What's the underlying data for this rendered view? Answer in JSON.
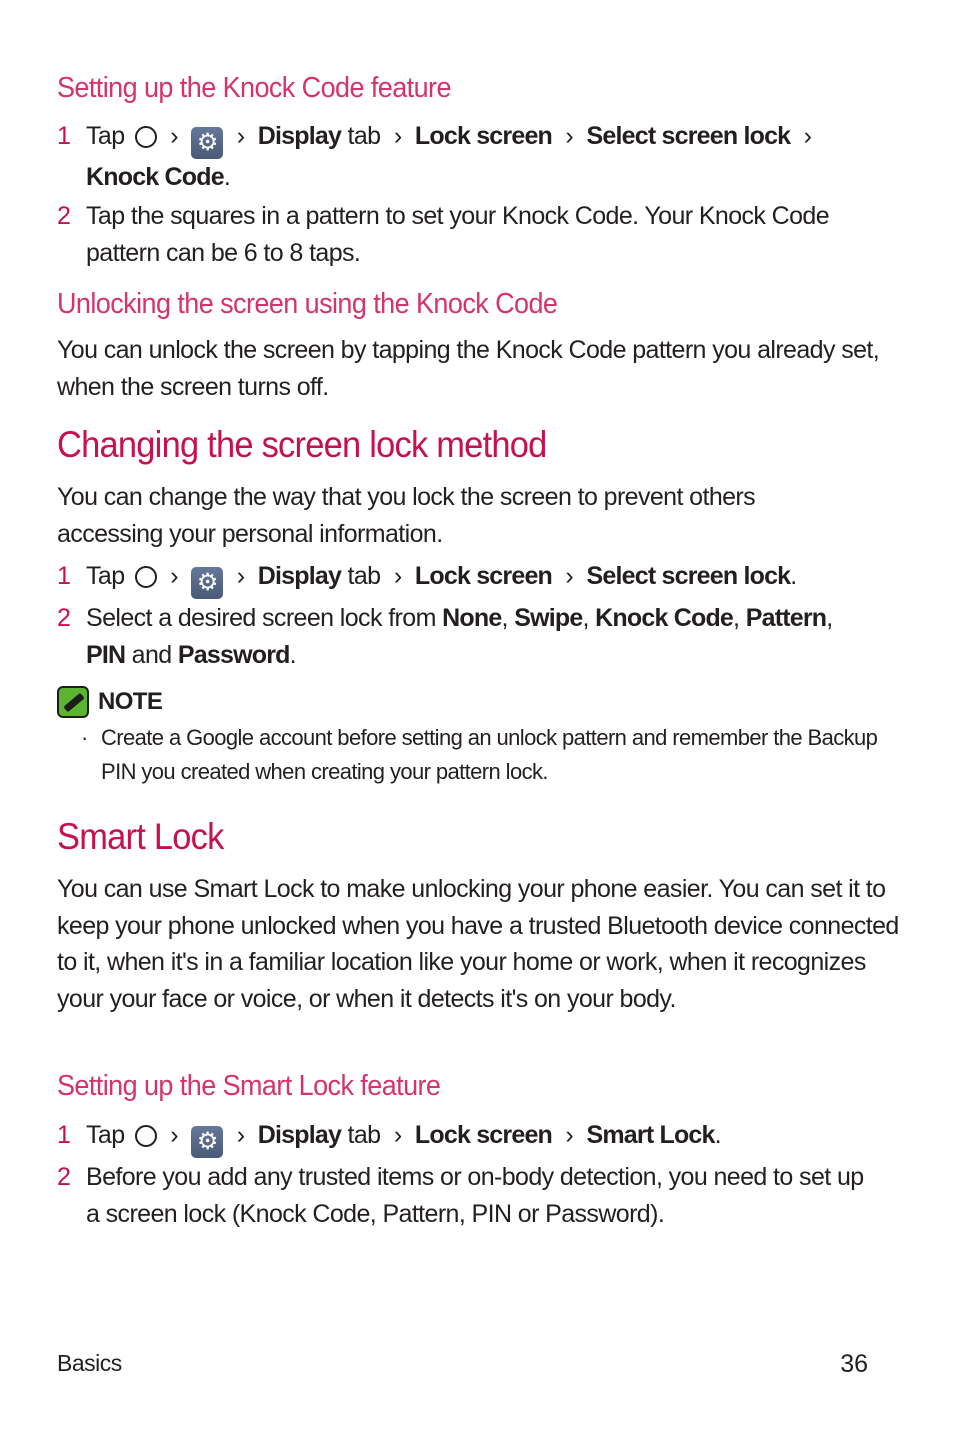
{
  "sections": {
    "knock_setup": {
      "heading": "Setting up the Knock Code feature",
      "step1": {
        "num": "1",
        "tap": "Tap",
        "display": "Display",
        "tab": "tab",
        "lock_screen": "Lock screen",
        "select_lock": "Select screen lock",
        "knock_code": "Knock Code",
        "end": "."
      },
      "step2": {
        "num": "2",
        "text": "Tap the squares in a pattern to set your Knock Code. Your Knock Code pattern can be 6 to 8 taps."
      }
    },
    "knock_unlock": {
      "heading": "Unlocking the screen using the Knock Code",
      "text": "You can unlock the screen by tapping the Knock Code pattern you already set, when the screen turns off."
    },
    "change_method": {
      "heading": "Changing the screen lock method",
      "text": "You can change the way that you lock the screen to prevent others accessing your personal information.",
      "step1": {
        "num": "1",
        "tap": "Tap",
        "display": "Display",
        "tab": "tab",
        "lock_screen": "Lock screen",
        "select_lock": "Select screen lock",
        "end": "."
      },
      "step2": {
        "num": "2",
        "intro": "Select a desired screen lock from",
        "opt_none": "None",
        "opt_swipe": "Swipe",
        "opt_knock": "Knock Code",
        "opt_pattern": "Pattern",
        "opt_pin": "PIN",
        "and": "and",
        "opt_password": "Password",
        "comma": ",",
        "end": "."
      },
      "note": {
        "label": "NOTE",
        "bullet": "·",
        "text": "Create a Google account before setting an unlock pattern and remember the Backup PIN you created when creating your pattern lock."
      }
    },
    "smart_lock": {
      "heading": "Smart Lock",
      "text": "You can use Smart Lock to make unlocking your phone easier. You can set it to keep your phone unlocked when you have a trusted Bluetooth device connected to it, when it's in a familiar location like your home or work, when it recognizes your your face or voice, or when it detects it's on your body."
    },
    "smart_setup": {
      "heading": "Setting up the Smart Lock feature",
      "step1": {
        "num": "1",
        "tap": "Tap",
        "display": "Display",
        "tab": "tab",
        "lock_screen": "Lock screen",
        "smart_lock": "Smart Lock",
        "end": "."
      },
      "step2": {
        "num": "2",
        "text": "Before you add any trusted items or on-body detection, you need to set up a screen lock (Knock Code, Pattern, PIN or Password)."
      }
    }
  },
  "separator": "›",
  "icons": {
    "home": "home-circle-icon",
    "settings": "settings-gear-icon",
    "note": "note-pencil-icon",
    "gear_glyph": "⚙"
  },
  "footer": {
    "section": "Basics",
    "page": "36"
  },
  "colors": {
    "subheading": "#d6336c",
    "heading": "#c8104e",
    "step_number": "#c8104e",
    "note_icon": "#5bb531"
  }
}
